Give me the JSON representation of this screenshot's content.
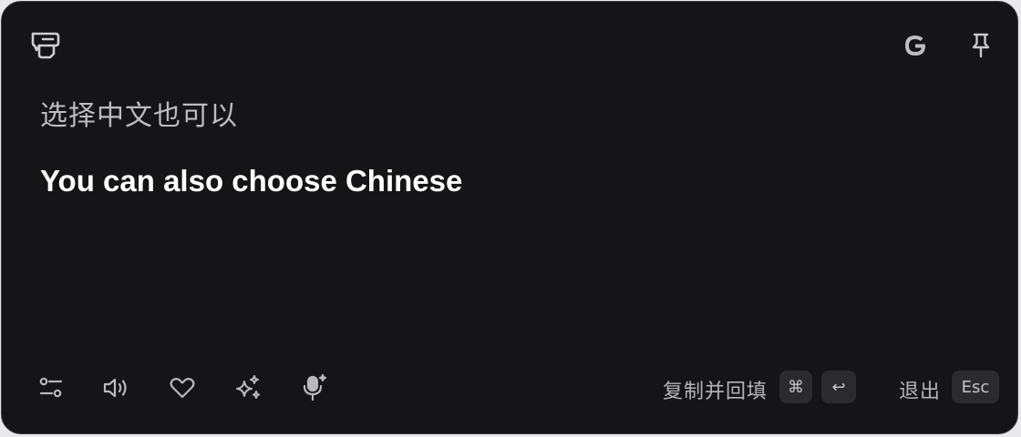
{
  "header": {
    "logo_icon": "translate-app-logo-icon",
    "engine_icon": "google-g-icon",
    "pin_icon": "pin-icon"
  },
  "content": {
    "source_text": "选择中文也可以",
    "translation_text": "You can also choose Chinese"
  },
  "toolbar": {
    "tools": [
      {
        "icon": "settings-sliders-icon"
      },
      {
        "icon": "speaker-icon"
      },
      {
        "icon": "heart-icon"
      },
      {
        "icon": "sparkle-icon"
      },
      {
        "icon": "microphone-icon"
      }
    ],
    "copy_fill_label": "复制并回填",
    "copy_fill_keys": [
      "⌘",
      "↩"
    ],
    "exit_label": "退出",
    "exit_key": "Esc"
  },
  "colors": {
    "background": "#151417",
    "border": "#3a3a3e",
    "primary_text": "#ffffff",
    "secondary_text": "#bdbdc0",
    "keycap_bg": "#2b2a2e"
  }
}
